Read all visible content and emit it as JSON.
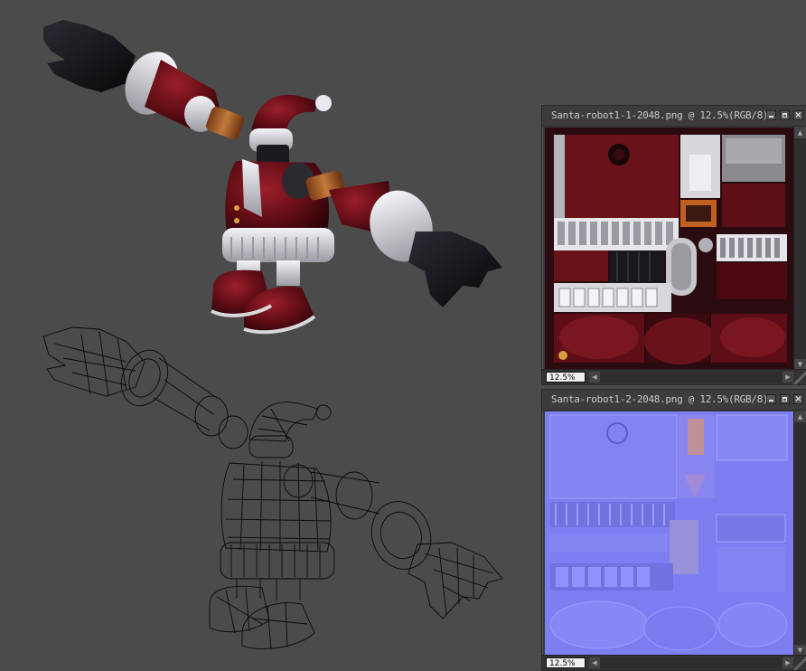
{
  "windows": [
    {
      "title": "Santa-robot1-1-2048.png @ 12.5%(RGB/8)",
      "zoom": "12.5%"
    },
    {
      "title": "Santa-robot1-2-2048.png @ 12.5%(RGB/8)",
      "zoom": "12.5%"
    }
  ],
  "icons": {
    "minimize": "minimize-icon",
    "maximize": "maximize-icon",
    "close": "close-icon",
    "scroll_up": "scroll-up-arrow-icon",
    "scroll_down": "scroll-down-arrow-icon",
    "scroll_left": "scroll-left-arrow-icon",
    "scroll_right": "scroll-right-arrow-icon"
  },
  "colors": {
    "viewport_bg": "#4b4b4b",
    "suit_red": "#6e1018",
    "fur_white": "#e6e6ea",
    "glove_black": "#141418",
    "normal_map_blue": "#8080f0"
  }
}
